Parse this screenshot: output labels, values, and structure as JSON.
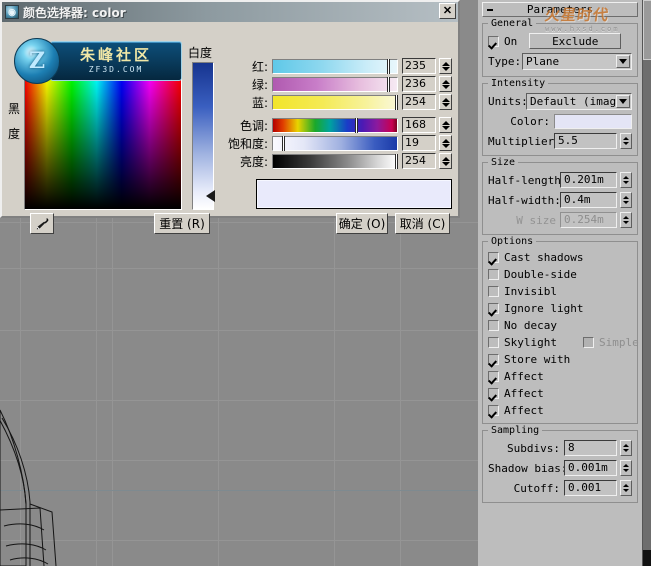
{
  "dialog": {
    "title": "颜色选择器: color",
    "close_label": "✕",
    "icon": "app-icon",
    "whiteness_label": "白度",
    "blackness_label_1": "黑",
    "blackness_label_2": "度",
    "sliders": [
      {
        "label": "红:",
        "value": "235",
        "thumb_pct": 92
      },
      {
        "label": "绿:",
        "value": "236",
        "thumb_pct": 92
      },
      {
        "label": "蓝:",
        "value": "254",
        "thumb_pct": 99
      },
      {
        "label": "色调:",
        "value": "168",
        "thumb_pct": 66
      },
      {
        "label": "饱和度:",
        "value": "19",
        "thumb_pct": 7
      },
      {
        "label": "亮度:",
        "value": "254",
        "thumb_pct": 99
      }
    ],
    "preview_color": "#e9eafb",
    "buttons": {
      "eyedropper": "eyedropper-icon",
      "reset": "重置 (R)",
      "ok": "确定 (O)",
      "cancel": "取消 (C)"
    }
  },
  "watermarks": {
    "zf_cn": "朱峰社区",
    "zf_en": "ZF3D.COM",
    "zf_glyph": "Z",
    "hxsd_cn": "火星时代",
    "hxsd_url": "www.hxsd.com"
  },
  "panel": {
    "rollout_title": "Parameters",
    "general": {
      "label": "General",
      "on_label": "On",
      "on_checked": true,
      "exclude_label": "Exclude",
      "type_label": "Type:",
      "type_value": "Plane"
    },
    "intensity": {
      "label": "Intensity",
      "units_label": "Units:",
      "units_value": "Default (image)",
      "color_label": "Color:",
      "color_value": "#e4e5f6",
      "multiplier_label": "Multiplier:",
      "multiplier_value": "5.5"
    },
    "size": {
      "label": "Size",
      "half_length_label": "Half-length:",
      "half_length_value": "0.201m",
      "half_width_label": "Half-width:",
      "half_width_value": "0.4m",
      "w_size_label": "W size",
      "w_size_value": "0.254m"
    },
    "options": {
      "label": "Options",
      "items": [
        {
          "label": "Cast shadows",
          "checked": true,
          "dim": false
        },
        {
          "label": "Double-side",
          "checked": false,
          "dim": false
        },
        {
          "label": "Invisibl",
          "checked": false,
          "dim": false
        },
        {
          "label": "Ignore light",
          "checked": true,
          "dim": false
        },
        {
          "label": "No decay",
          "checked": false,
          "dim": false
        },
        {
          "label": "Skylight",
          "checked": false,
          "dim": false
        },
        {
          "label": "Store with",
          "checked": true,
          "dim": false
        },
        {
          "label": "Affect",
          "checked": true,
          "dim": false
        },
        {
          "label": "Affect",
          "checked": true,
          "dim": false
        },
        {
          "label": "Affect",
          "checked": true,
          "dim": false
        }
      ],
      "simple_label": "Simple",
      "simple_checked": false
    },
    "sampling": {
      "label": "Sampling",
      "subdivs_label": "Subdivs:",
      "subdivs_value": "8",
      "shadow_bias_label": "Shadow bias:",
      "shadow_bias_value": "0.001m",
      "cutoff_label": "Cutoff:",
      "cutoff_value": "0.001"
    }
  }
}
